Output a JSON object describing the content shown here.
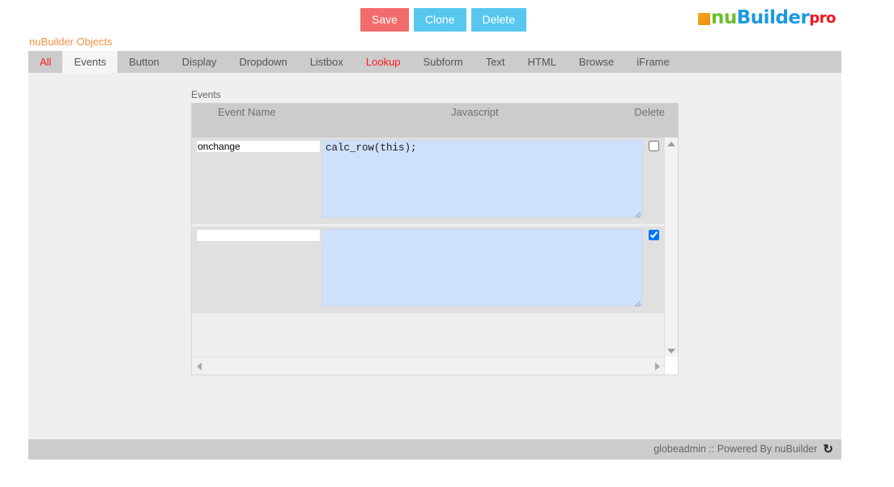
{
  "toolbar": {
    "save_label": "Save",
    "clone_label": "Clone",
    "delete_label": "Delete",
    "save_color": "#f36c6c",
    "clone_color": "#57c7ef",
    "delete_color": "#57c7ef"
  },
  "logo": {
    "part1": "nu",
    "part2": "Builder",
    "part3": "pro",
    "square_color": "#f08c10",
    "nu_color": "#6abf2a",
    "builder_color": "#1b9ae0",
    "pro_color": "#f2141c"
  },
  "panel": {
    "title": "nuBuilder Objects",
    "title_color": "#f29240"
  },
  "tabs": [
    {
      "label": "All",
      "active": false,
      "highlight": true
    },
    {
      "label": "Events",
      "active": true,
      "highlight": false
    },
    {
      "label": "Button",
      "active": false,
      "highlight": false
    },
    {
      "label": "Display",
      "active": false,
      "highlight": false
    },
    {
      "label": "Dropdown",
      "active": false,
      "highlight": false
    },
    {
      "label": "Listbox",
      "active": false,
      "highlight": false
    },
    {
      "label": "Lookup",
      "active": false,
      "highlight": true
    },
    {
      "label": "Subform",
      "active": false,
      "highlight": false
    },
    {
      "label": "Text",
      "active": false,
      "highlight": false
    },
    {
      "label": "HTML",
      "active": false,
      "highlight": false
    },
    {
      "label": "Browse",
      "active": false,
      "highlight": false
    },
    {
      "label": "iFrame",
      "active": false,
      "highlight": false
    }
  ],
  "subform": {
    "label": "Events",
    "columns": [
      "Event Name",
      "Javascript",
      "Delete"
    ],
    "rows": [
      {
        "event_name": "onchange",
        "javascript": "calc_row(this);",
        "delete_checked": false
      },
      {
        "event_name": "",
        "javascript": "",
        "delete_checked": true
      }
    ],
    "name_placeholder": "",
    "js_placeholder": ""
  },
  "scrollbars": {
    "vertical_up": "scroll-up-arrow",
    "vertical_down": "scroll-down-arrow",
    "horizontal_left": "scroll-left-arrow",
    "horizontal_right": "scroll-right-arrow"
  },
  "footer": {
    "text": "globeadmin :: Powered By nuBuilder",
    "icon": "refresh-icon",
    "icon_glyph": "↻"
  }
}
